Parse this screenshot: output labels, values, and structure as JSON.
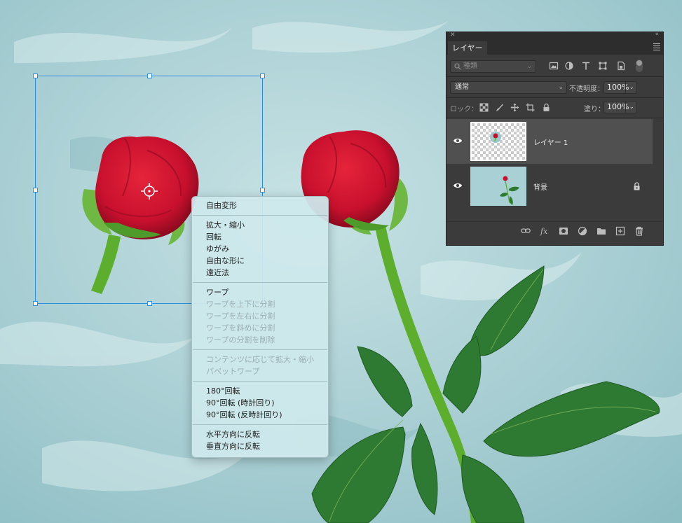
{
  "context_menu": {
    "groups": [
      [
        {
          "label": "自由変形",
          "enabled": true
        }
      ],
      [
        {
          "label": "拡大・縮小",
          "enabled": true
        },
        {
          "label": "回転",
          "enabled": true
        },
        {
          "label": "ゆがみ",
          "enabled": true
        },
        {
          "label": "自由な形に",
          "enabled": true
        },
        {
          "label": "遠近法",
          "enabled": true
        }
      ],
      [
        {
          "label": "ワープ",
          "enabled": true
        },
        {
          "label": "ワープを上下に分割",
          "enabled": false
        },
        {
          "label": "ワープを左右に分割",
          "enabled": false
        },
        {
          "label": "ワープを斜めに分割",
          "enabled": false
        },
        {
          "label": "ワープの分割を削除",
          "enabled": false
        }
      ],
      [
        {
          "label": "コンテンツに応じて拡大・縮小",
          "enabled": false
        },
        {
          "label": "パペットワープ",
          "enabled": false
        }
      ],
      [
        {
          "label": "180°回転",
          "enabled": true
        },
        {
          "label": "90°回転 (時計回り)",
          "enabled": true
        },
        {
          "label": "90°回転 (反時計回り)",
          "enabled": true
        }
      ],
      [
        {
          "label": "水平方向に反転",
          "enabled": true
        },
        {
          "label": "垂直方向に反転",
          "enabled": true
        }
      ]
    ]
  },
  "layers_panel": {
    "tab_label": "レイヤー",
    "search_placeholder": "種類",
    "filter_icons": [
      "image-filter-icon",
      "adjustment-filter-icon",
      "type-filter-icon",
      "shape-filter-icon",
      "smart-object-filter-icon"
    ],
    "blend_mode": "通常",
    "opacity_label": "不透明度：",
    "opacity_value": "100%",
    "lock_label": "ロック：",
    "lock_icons": [
      "lock-transparent-icon",
      "lock-image-icon",
      "lock-position-icon",
      "lock-artboard-icon",
      "lock-all-icon"
    ],
    "fill_label": "塗り：",
    "fill_value": "100%",
    "layers": [
      {
        "name": "レイヤー 1",
        "selected": true,
        "visible": true,
        "locked": false
      },
      {
        "name": "背景",
        "selected": false,
        "visible": true,
        "locked": true
      }
    ],
    "footer_icons": [
      "link-layers-icon",
      "fx-icon",
      "add-mask-icon",
      "adjustment-layer-icon",
      "new-group-icon",
      "new-layer-icon",
      "delete-layer-icon"
    ]
  },
  "colors": {
    "canvas": "#9cc7cc",
    "selection": "#2d8ee6",
    "rose_red": "#c8102e",
    "stem_green": "#5cae2c",
    "leaf_green": "#2f7a32",
    "panel_bg": "#3b3b3b"
  }
}
